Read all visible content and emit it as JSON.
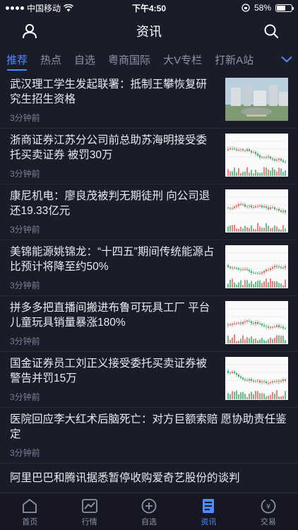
{
  "status_bar": {
    "carrier": "中国移动",
    "time": "下午4:50",
    "battery_text": "58%",
    "battery_level": 0.58
  },
  "header": {
    "title": "资讯",
    "left_icon": "user-icon",
    "right_icon": "search-icon"
  },
  "tabs": [
    {
      "label": "推荐",
      "active": true
    },
    {
      "label": "热点",
      "active": false
    },
    {
      "label": "自选",
      "active": false
    },
    {
      "label": "粤商国际",
      "active": false
    },
    {
      "label": "大V专栏",
      "active": false
    },
    {
      "label": "打新A站",
      "active": false
    }
  ],
  "news": [
    {
      "title": "武汉理工学生发起联署：抵制王攀恢复研究生招生资格",
      "time": "3分钟前",
      "thumb": "photo"
    },
    {
      "title": "浙商证券江苏分公司前总助苏海明接受委托买卖证券 被罚30万",
      "time": "3分钟前",
      "thumb": "chart"
    },
    {
      "title": "康尼机电：廖良茂被判无期徒刑 向公司退还19.33亿元",
      "time": "3分钟前",
      "thumb": "chart"
    },
    {
      "title": "美锦能源姚锦龙：“十四五”期间传统能源占比预计将降至约50%",
      "time": "3分钟前",
      "thumb": "chart"
    },
    {
      "title": "拼多多把直播间搬进布鲁可玩具工厂 平台儿童玩具销量暴涨180%",
      "time": "3分钟前",
      "thumb": "chart"
    },
    {
      "title": "国金证券员工刘正义接受委托买卖证券被警告并罚15万",
      "time": "3分钟前",
      "thumb": "chart"
    },
    {
      "title": "医院回应李大红术后脑死亡：对方巨额索赔 愿协助责任鉴定",
      "time": "3分钟前",
      "thumb": "none"
    },
    {
      "title": "阿里巴巴和腾讯据悉暂停收购爱奇艺股份的谈判",
      "time": "",
      "thumb": "none"
    }
  ],
  "bottom_nav": [
    {
      "label": "首页",
      "icon": "home-icon",
      "active": false
    },
    {
      "label": "行情",
      "icon": "market-chart-icon",
      "active": false
    },
    {
      "label": "自选",
      "icon": "add-circle-icon",
      "active": false
    },
    {
      "label": "资讯",
      "icon": "news-icon",
      "active": true
    },
    {
      "label": "交易",
      "icon": "trade-icon",
      "active": false
    }
  ],
  "colors": {
    "background": "#1b1c29",
    "accent": "#4d8cff",
    "muted_text": "#8e92a6"
  }
}
